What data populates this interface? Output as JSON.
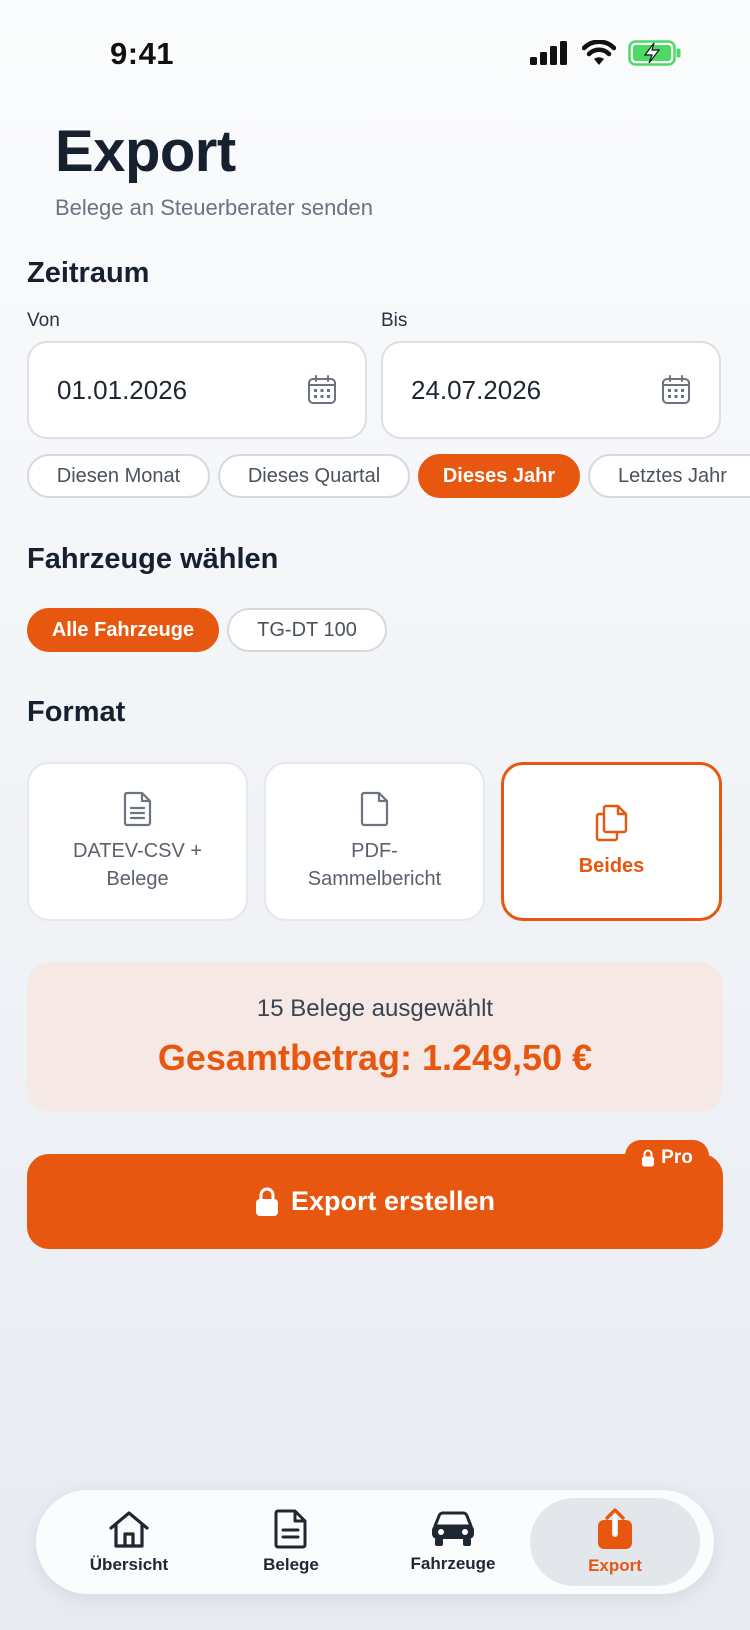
{
  "status_bar": {
    "time": "9:41",
    "icons": [
      "signal-icon",
      "wifi-icon",
      "battery-charging-icon"
    ],
    "battery_color": "#4cd964"
  },
  "header": {
    "title": "Export",
    "subtitle": "Belege an Steuerberater senden"
  },
  "period": {
    "section_title": "Zeitraum",
    "from_label": "Von",
    "from_value": "01.01.2026",
    "to_label": "Bis",
    "to_value": "24.07.2026",
    "presets": [
      {
        "label": "Diesen Monat",
        "active": false
      },
      {
        "label": "Dieses Quartal",
        "active": false
      },
      {
        "label": "Dieses Jahr",
        "active": true
      },
      {
        "label": "Letztes Jahr",
        "active": false
      }
    ]
  },
  "vehicles": {
    "section_title": "Fahrzeuge wählen",
    "options": [
      {
        "label": "Alle Fahrzeuge",
        "active": true
      },
      {
        "label": "TG-DT 100",
        "active": false
      }
    ]
  },
  "format": {
    "section_title": "Format",
    "options": [
      {
        "label": "DATEV-CSV + Belege",
        "icon": "document-lines-icon",
        "active": false
      },
      {
        "label": "PDF-Sammelbericht",
        "icon": "document-icon",
        "active": false
      },
      {
        "label": "Beides",
        "icon": "documents-copy-icon",
        "active": true
      }
    ]
  },
  "summary": {
    "count_text": "15 Belege ausgewählt",
    "total_text": "Gesamtbetrag: 1.249,50 €"
  },
  "export_button": {
    "label": "Export erstellen",
    "badge": "Pro"
  },
  "tab_bar": {
    "tabs": [
      {
        "label": "Übersicht",
        "icon": "home-icon",
        "active": false
      },
      {
        "label": "Belege",
        "icon": "receipt-icon",
        "active": false
      },
      {
        "label": "Fahrzeuge",
        "icon": "car-icon",
        "active": false
      },
      {
        "label": "Export",
        "icon": "export-icon",
        "active": true
      }
    ]
  },
  "colors": {
    "accent": "#e8570f",
    "summary_background": "#f6e9e5",
    "text_primary": "#17202e"
  }
}
